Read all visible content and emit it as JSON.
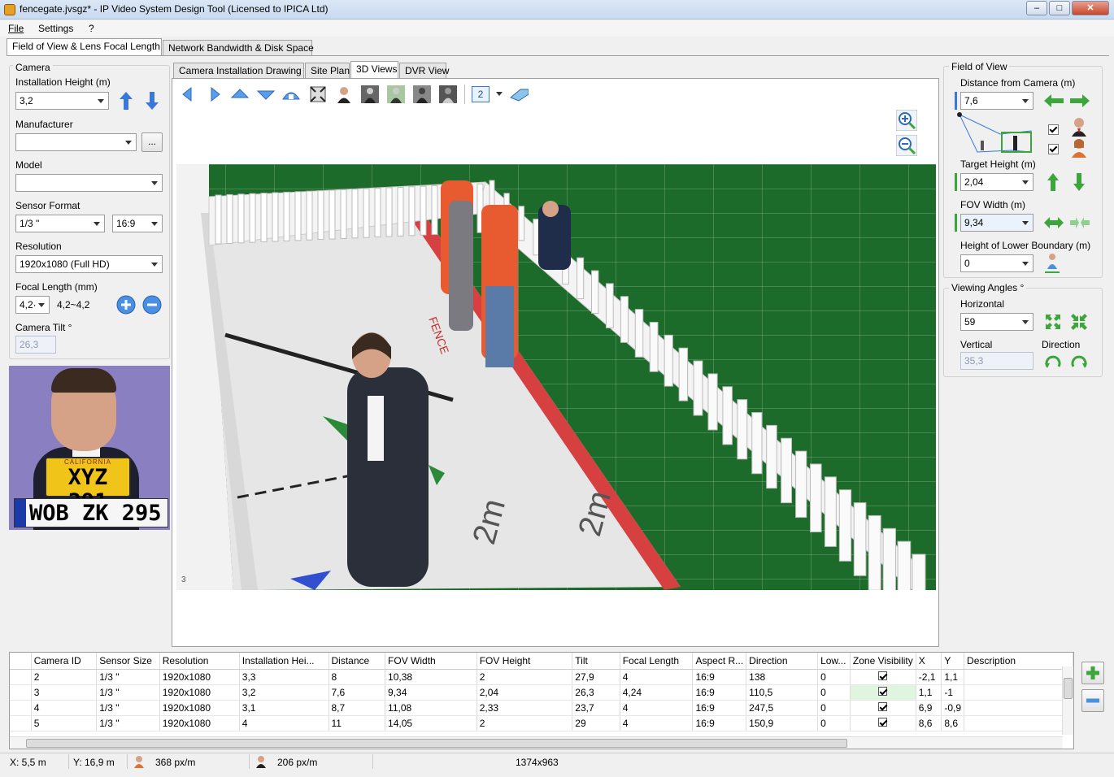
{
  "window": {
    "title": "fencegate.jvsgz* - IP Video System Design Tool (Licensed to IPICA Ltd)"
  },
  "menu": {
    "file": "File",
    "settings": "Settings",
    "help": "?"
  },
  "main_tabs": [
    "Field of View & Lens Focal Length",
    "Network Bandwidth & Disk Space"
  ],
  "left": {
    "camera_group": "Camera",
    "install_height_label": "Installation Height (m)",
    "install_height": "3,2",
    "manufacturer_label": "Manufacturer",
    "manufacturer": "",
    "browse": "...",
    "model_label": "Model",
    "model": "",
    "sensor_label": "Sensor Format",
    "sensor": "1/3 \"",
    "aspect": "16:9",
    "resolution_label": "Resolution",
    "resolution": "1920x1080 (Full HD)",
    "focal_label": "Focal Length (mm)",
    "focal": "4,2·",
    "focal_range": "4,2~4,2",
    "tilt_label": "Camera Tilt °",
    "tilt": "26,3",
    "plate1_top": "CALIFORNIA",
    "plate1": "XYZ 391",
    "plate2": "WOB ZK 295"
  },
  "view_tabs": [
    "Camera Installation Drawing",
    "Site Plan",
    "3D Views",
    "DVR View"
  ],
  "toolbar": {
    "camera_num": "2"
  },
  "scene": {
    "corner_num": "3",
    "fence_text": "FENCE",
    "floor_text": "2m"
  },
  "right": {
    "fov_group": "Field of View",
    "distance_label": "Distance from Camera  (m)",
    "distance": "7,6",
    "target_label": "Target Height (m)",
    "target": "2,04",
    "fov_width_label": "FOV Width (m)",
    "fov_width": "9,34",
    "lower_label": "Height of Lower Boundary (m)",
    "lower": "0",
    "angles_group": "Viewing Angles °",
    "horizontal_label": "Horizontal",
    "horizontal": "59",
    "vertical_label": "Vertical",
    "vertical": "35,3",
    "direction_label": "Direction"
  },
  "table": {
    "headers": [
      "Camera ID",
      "Sensor Size",
      "Resolution",
      "Installation Hei...",
      "Distance",
      "FOV Width",
      "FOV Height",
      "Tilt",
      "Focal Length",
      "Aspect R...",
      "Direction",
      "Low...",
      "Zone Visibility",
      "X",
      "Y",
      "Description"
    ],
    "rows": [
      [
        "2",
        "1/3 \"",
        "1920x1080",
        "3,3",
        "8",
        "10,38",
        "2",
        "27,9",
        "4",
        "16:9",
        "138",
        "0",
        "",
        "-2,1",
        "1,1",
        ""
      ],
      [
        "3",
        "1/3 \"",
        "1920x1080",
        "3,2",
        "7,6",
        "9,34",
        "2,04",
        "26,3",
        "4,24",
        "16:9",
        "110,5",
        "0",
        "",
        "1,1",
        "-1",
        ""
      ],
      [
        "4",
        "1/3 \"",
        "1920x1080",
        "3,1",
        "8,7",
        "11,08",
        "2,33",
        "23,7",
        "4",
        "16:9",
        "247,5",
        "0",
        "",
        "6,9",
        "-0,9",
        ""
      ],
      [
        "5",
        "1/3 \"",
        "1920x1080",
        "4",
        "11",
        "14,05",
        "2",
        "29",
        "4",
        "16:9",
        "150,9",
        "0",
        "",
        "8,6",
        "8,6",
        ""
      ]
    ]
  },
  "status": {
    "x": "X: 5,5 m",
    "y": "Y: 16,9 m",
    "px1": "368 px/m",
    "px2": "206 px/m",
    "size": "1374x963"
  },
  "colors": {
    "accent": "#3a78d8",
    "green": "#3ca63c",
    "scene_ground": "#1d6b2a"
  }
}
